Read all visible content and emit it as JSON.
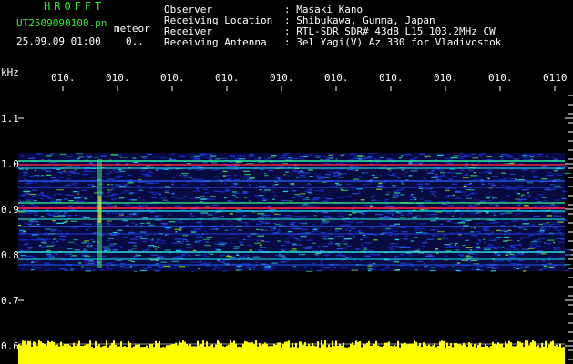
{
  "header": {
    "title": "HROFFT",
    "filename": "UT2509090100.pn",
    "meteor_label": "meteor",
    "datetime": "25.09.09 01:00",
    "count": "0..",
    "fields": [
      {
        "label": "Observer",
        "value": ": Masaki Kano"
      },
      {
        "label": "Receiving Location",
        "value": ": Shibukawa, Gunma, Japan"
      },
      {
        "label": "Receiver",
        "value": ": RTL-SDR SDR# 43dB L15 103.2MHz CW"
      },
      {
        "label": "Receiving Antenna",
        "value": ": 3el Yagi(V) Az 330 for Vladivostok"
      }
    ]
  },
  "axes": {
    "y_unit": "kHz",
    "y_ticks": [
      "1.1",
      "1.0",
      "0.9",
      "0.8",
      "0.7",
      "0.6"
    ],
    "x_ticks": [
      "010.",
      "010.",
      "010.",
      "010.",
      "010.",
      "010.",
      "010.",
      "010.",
      "010.",
      "0110"
    ]
  },
  "colors": {
    "header_green": "#2ee82e",
    "background": "#000000",
    "amplitude_bar": "#ffff00",
    "signal_red": "#ff2040",
    "noise_blue": "#1830d8",
    "noise_cyan": "#20d0e0"
  }
}
